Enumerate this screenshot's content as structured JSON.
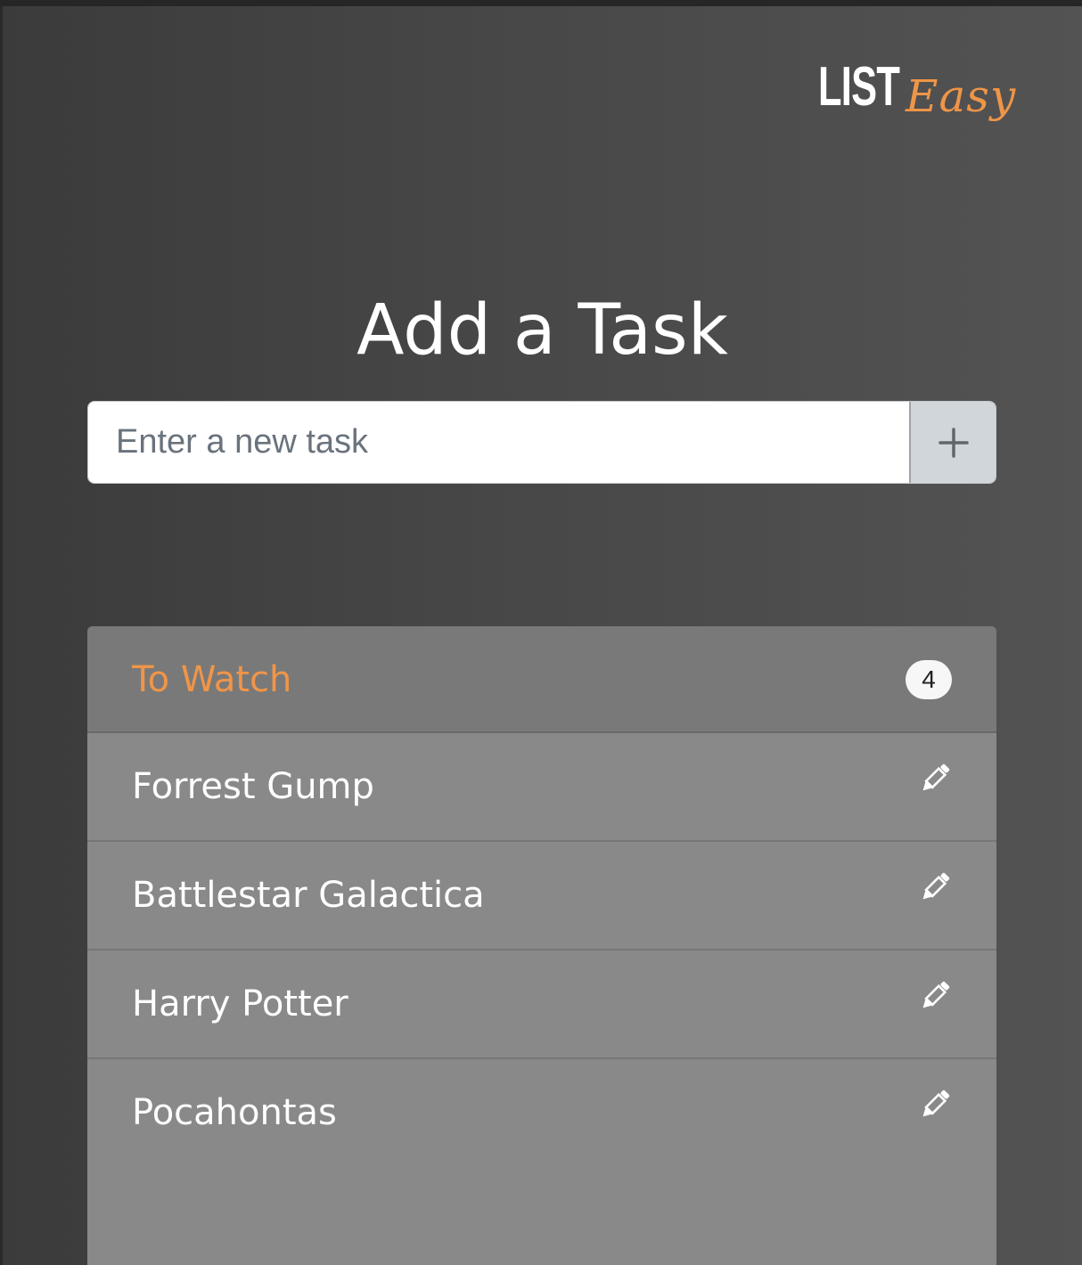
{
  "logo": {
    "part1": "LIST",
    "part2": "Easy",
    "accent_color": "#ef9548"
  },
  "page": {
    "title": "Add a Task"
  },
  "task_input": {
    "placeholder": "Enter a new task",
    "value": "",
    "add_icon": "plus-icon"
  },
  "list": {
    "title": "To Watch",
    "count": "4",
    "title_color": "#f09548",
    "items": [
      {
        "label": "Forrest Gump",
        "icon": "pencil-icon"
      },
      {
        "label": "Battlestar Galactica",
        "icon": "pencil-icon"
      },
      {
        "label": "Harry Potter",
        "icon": "pencil-icon"
      },
      {
        "label": "Pocahontas",
        "icon": "pencil-icon"
      }
    ]
  }
}
